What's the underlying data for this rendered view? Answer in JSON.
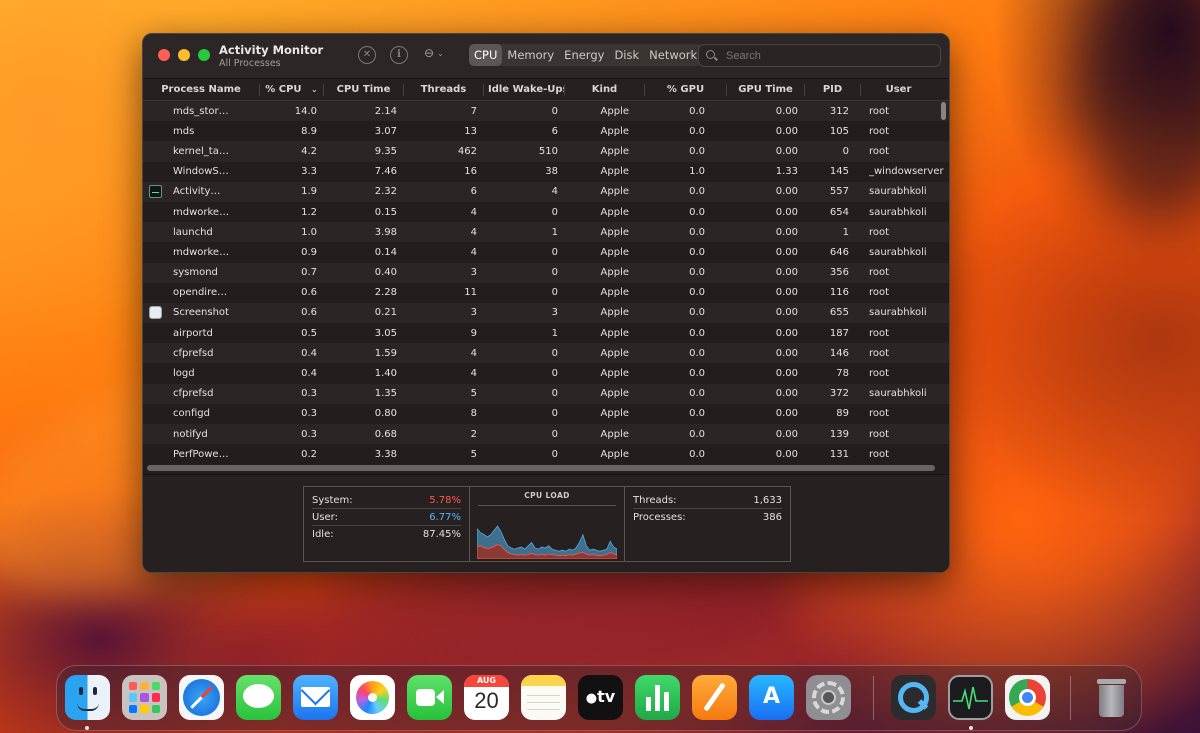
{
  "window": {
    "title": "Activity Monitor",
    "subtitle": "All Processes",
    "tabs": [
      "CPU",
      "Memory",
      "Energy",
      "Disk",
      "Network"
    ],
    "active_tab": "CPU",
    "search_placeholder": "Search",
    "stop_icon": "x-circle-icon",
    "info_icon": "info-circle-icon",
    "more_icon": "ellipsis-menu-icon"
  },
  "table": {
    "headers": {
      "process_name": "Process Name",
      "cpu": "% CPU",
      "cpu_time": "CPU Time",
      "threads": "Threads",
      "idle_wakeups": "Idle Wake-Ups",
      "kind": "Kind",
      "gpu": "% GPU",
      "gpu_time": "GPU Time",
      "pid": "PID",
      "user": "User"
    },
    "sort_column": "% CPU",
    "rows": [
      {
        "name": "mds_stor…",
        "cpu": "14.0",
        "time": "2.14",
        "threads": "7",
        "wake": "0",
        "kind": "Apple",
        "gpu": "0.0",
        "gtime": "0.00",
        "pid": "312",
        "user": "root",
        "icon": ""
      },
      {
        "name": "mds",
        "cpu": "8.9",
        "time": "3.07",
        "threads": "13",
        "wake": "6",
        "kind": "Apple",
        "gpu": "0.0",
        "gtime": "0.00",
        "pid": "105",
        "user": "root",
        "icon": ""
      },
      {
        "name": "kernel_ta…",
        "cpu": "4.2",
        "time": "9.35",
        "threads": "462",
        "wake": "510",
        "kind": "Apple",
        "gpu": "0.0",
        "gtime": "0.00",
        "pid": "0",
        "user": "root",
        "icon": ""
      },
      {
        "name": "WindowS…",
        "cpu": "3.3",
        "time": "7.46",
        "threads": "16",
        "wake": "38",
        "kind": "Apple",
        "gpu": "1.0",
        "gtime": "1.33",
        "pid": "145",
        "user": "_windowserver",
        "icon": ""
      },
      {
        "name": "Activity…",
        "cpu": "1.9",
        "time": "2.32",
        "threads": "6",
        "wake": "4",
        "kind": "Apple",
        "gpu": "0.0",
        "gtime": "0.00",
        "pid": "557",
        "user": "saurabhkoli",
        "icon": "activity-monitor-app-icon"
      },
      {
        "name": "mdworke…",
        "cpu": "1.2",
        "time": "0.15",
        "threads": "4",
        "wake": "0",
        "kind": "Apple",
        "gpu": "0.0",
        "gtime": "0.00",
        "pid": "654",
        "user": "saurabhkoli",
        "icon": ""
      },
      {
        "name": "launchd",
        "cpu": "1.0",
        "time": "3.98",
        "threads": "4",
        "wake": "1",
        "kind": "Apple",
        "gpu": "0.0",
        "gtime": "0.00",
        "pid": "1",
        "user": "root",
        "icon": ""
      },
      {
        "name": "mdworke…",
        "cpu": "0.9",
        "time": "0.14",
        "threads": "4",
        "wake": "0",
        "kind": "Apple",
        "gpu": "0.0",
        "gtime": "0.00",
        "pid": "646",
        "user": "saurabhkoli",
        "icon": ""
      },
      {
        "name": "sysmond",
        "cpu": "0.7",
        "time": "0.40",
        "threads": "3",
        "wake": "0",
        "kind": "Apple",
        "gpu": "0.0",
        "gtime": "0.00",
        "pid": "356",
        "user": "root",
        "icon": ""
      },
      {
        "name": "opendire…",
        "cpu": "0.6",
        "time": "2.28",
        "threads": "11",
        "wake": "0",
        "kind": "Apple",
        "gpu": "0.0",
        "gtime": "0.00",
        "pid": "116",
        "user": "root",
        "icon": ""
      },
      {
        "name": "Screenshot",
        "cpu": "0.6",
        "time": "0.21",
        "threads": "3",
        "wake": "3",
        "kind": "Apple",
        "gpu": "0.0",
        "gtime": "0.00",
        "pid": "655",
        "user": "saurabhkoli",
        "icon": "screenshot-app-icon"
      },
      {
        "name": "airportd",
        "cpu": "0.5",
        "time": "3.05",
        "threads": "9",
        "wake": "1",
        "kind": "Apple",
        "gpu": "0.0",
        "gtime": "0.00",
        "pid": "187",
        "user": "root",
        "icon": ""
      },
      {
        "name": "cfprefsd",
        "cpu": "0.4",
        "time": "1.59",
        "threads": "4",
        "wake": "0",
        "kind": "Apple",
        "gpu": "0.0",
        "gtime": "0.00",
        "pid": "146",
        "user": "root",
        "icon": ""
      },
      {
        "name": "logd",
        "cpu": "0.4",
        "time": "1.40",
        "threads": "4",
        "wake": "0",
        "kind": "Apple",
        "gpu": "0.0",
        "gtime": "0.00",
        "pid": "78",
        "user": "root",
        "icon": ""
      },
      {
        "name": "cfprefsd",
        "cpu": "0.3",
        "time": "1.35",
        "threads": "5",
        "wake": "0",
        "kind": "Apple",
        "gpu": "0.0",
        "gtime": "0.00",
        "pid": "372",
        "user": "saurabhkoli",
        "icon": ""
      },
      {
        "name": "configd",
        "cpu": "0.3",
        "time": "0.80",
        "threads": "8",
        "wake": "0",
        "kind": "Apple",
        "gpu": "0.0",
        "gtime": "0.00",
        "pid": "89",
        "user": "root",
        "icon": ""
      },
      {
        "name": "notifyd",
        "cpu": "0.3",
        "time": "0.68",
        "threads": "2",
        "wake": "0",
        "kind": "Apple",
        "gpu": "0.0",
        "gtime": "0.00",
        "pid": "139",
        "user": "root",
        "icon": ""
      },
      {
        "name": "PerfPowe…",
        "cpu": "0.2",
        "time": "3.38",
        "threads": "5",
        "wake": "0",
        "kind": "Apple",
        "gpu": "0.0",
        "gtime": "0.00",
        "pid": "131",
        "user": "root",
        "icon": ""
      }
    ]
  },
  "summary": {
    "system_label": "System:",
    "system_value": "5.78%",
    "user_label": "User:",
    "user_value": "6.77%",
    "idle_label": "Idle:",
    "idle_value": "87.45%",
    "cpu_load_title": "CPU LOAD",
    "threads_label": "Threads:",
    "threads_value": "1,633",
    "processes_label": "Processes:",
    "processes_value": "386",
    "colors": {
      "system": "#ff5a4e",
      "user": "#53b6ff"
    }
  },
  "cpu_load_history": {
    "system_pct": [
      22,
      24,
      21,
      19,
      20,
      23,
      26,
      24,
      17,
      12,
      9,
      8,
      7,
      8,
      7,
      8,
      10,
      8,
      7,
      8,
      7,
      9,
      8,
      7,
      6,
      7,
      6,
      8,
      7,
      9,
      11,
      12,
      9,
      7,
      8,
      7,
      6,
      7,
      8,
      12,
      9,
      8
    ],
    "user_pct": [
      55,
      48,
      45,
      40,
      44,
      52,
      60,
      50,
      36,
      24,
      20,
      18,
      20,
      22,
      18,
      24,
      30,
      20,
      18,
      22,
      20,
      24,
      18,
      16,
      14,
      16,
      14,
      18,
      16,
      20,
      30,
      44,
      24,
      16,
      18,
      16,
      14,
      16,
      18,
      32,
      22,
      18
    ]
  },
  "dock": {
    "apps": [
      {
        "name": "Finder",
        "icon": "finder-icon",
        "running": true
      },
      {
        "name": "Launchpad",
        "icon": "launchpad-icon",
        "running": false
      },
      {
        "name": "Safari",
        "icon": "safari-icon",
        "running": false
      },
      {
        "name": "Messages",
        "icon": "messages-icon",
        "running": false
      },
      {
        "name": "Mail",
        "icon": "mail-icon",
        "running": false
      },
      {
        "name": "Photos",
        "icon": "photos-icon",
        "running": false
      },
      {
        "name": "FaceTime",
        "icon": "facetime-icon",
        "running": false
      },
      {
        "name": "Calendar",
        "icon": "calendar-icon",
        "running": false,
        "month": "AUG",
        "day": "20"
      },
      {
        "name": "Notes",
        "icon": "notes-icon",
        "running": false
      },
      {
        "name": "TV",
        "icon": "apple-tv-icon",
        "running": false,
        "label": "tv"
      },
      {
        "name": "Numbers",
        "icon": "numbers-icon",
        "running": false
      },
      {
        "name": "Pages",
        "icon": "pages-icon",
        "running": false
      },
      {
        "name": "App Store",
        "icon": "app-store-icon",
        "running": false
      },
      {
        "name": "System Preferences",
        "icon": "system-preferences-icon",
        "running": false
      },
      {
        "name": "QuickTime Player",
        "icon": "quicktime-icon",
        "running": false
      },
      {
        "name": "Activity Monitor",
        "icon": "activity-monitor-icon",
        "running": true
      },
      {
        "name": "Google Chrome",
        "icon": "chrome-icon",
        "running": false
      },
      {
        "name": "Trash",
        "icon": "trash-icon",
        "running": false
      }
    ]
  }
}
